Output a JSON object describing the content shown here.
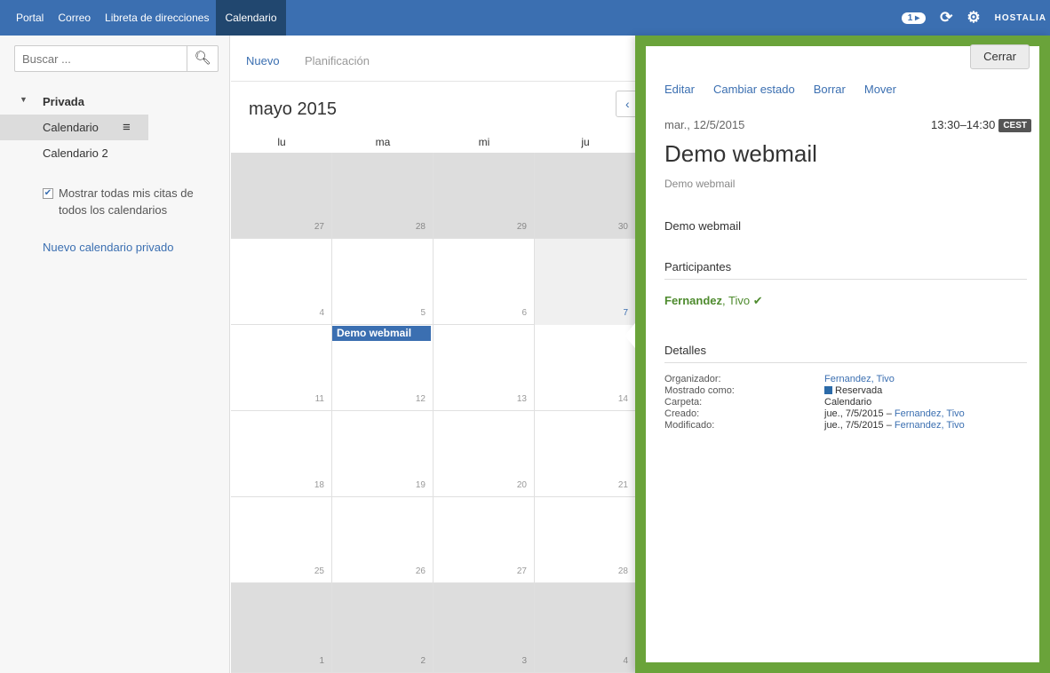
{
  "topbar": {
    "tabs": [
      {
        "label": "Portal",
        "active": false
      },
      {
        "label": "Correo",
        "active": false
      },
      {
        "label": "Libreta de direcciones",
        "active": false
      },
      {
        "label": "Calendario",
        "active": true
      }
    ],
    "notification_count": "1",
    "brand": "HOSTALIA",
    "icons": [
      "notifications-badge",
      "refresh-icon",
      "settings-gear-icon"
    ],
    "color": "#3b6fb1"
  },
  "sidebar": {
    "search_placeholder": "Buscar ...",
    "folder_title": "Privada",
    "calendars": [
      {
        "label": "Calendario",
        "selected": true
      },
      {
        "label": "Calendario 2",
        "selected": false
      }
    ],
    "show_all_label": "Mostrar todas mis citas de todos los calendarios",
    "show_all_checked": true,
    "new_calendar_link": "Nuevo calendario privado"
  },
  "main": {
    "new_label": "Nuevo",
    "planning_label": "Planificación",
    "month_title": "mayo 2015",
    "weekdays": [
      "lu",
      "ma",
      "mi",
      "ju"
    ],
    "weeks": [
      [
        "27",
        "28",
        "29",
        "30"
      ],
      [
        "4",
        "5",
        "6",
        "7"
      ],
      [
        "11",
        "12",
        "13",
        "14"
      ],
      [
        "18",
        "19",
        "20",
        "21"
      ],
      [
        "25",
        "26",
        "27",
        "28"
      ],
      [
        "1",
        "2",
        "3",
        "4"
      ]
    ],
    "event_label": "Demo webmail"
  },
  "panel": {
    "close_label": "Cerrar",
    "actions": [
      "Editar",
      "Cambiar estado",
      "Borrar",
      "Mover"
    ],
    "date": "mar., 12/5/2015",
    "time": "13:30–14:30",
    "timezone": "CEST",
    "title": "Demo webmail",
    "subtitle": "Demo webmail",
    "description": "Demo webmail",
    "participants_heading": "Participantes",
    "participant_last": "Fernandez",
    "participant_first": ", Tivo",
    "details_heading": "Detalles",
    "details": {
      "organizer_label": "Organizador:",
      "organizer_value": "Fernandez, Tivo",
      "shown_as_label": "Mostrado como:",
      "shown_as_value": "Reservada",
      "folder_label": "Carpeta:",
      "folder_value": "Calendario",
      "created_label": "Creado:",
      "created_date": "jue., 7/5/2015 –",
      "created_by": "Fernandez, Tivo",
      "modified_label": "Modificado:",
      "modified_date": "jue., 7/5/2015 –",
      "modified_by": "Fernandez, Tivo"
    },
    "border_color": "#6aa33a"
  }
}
